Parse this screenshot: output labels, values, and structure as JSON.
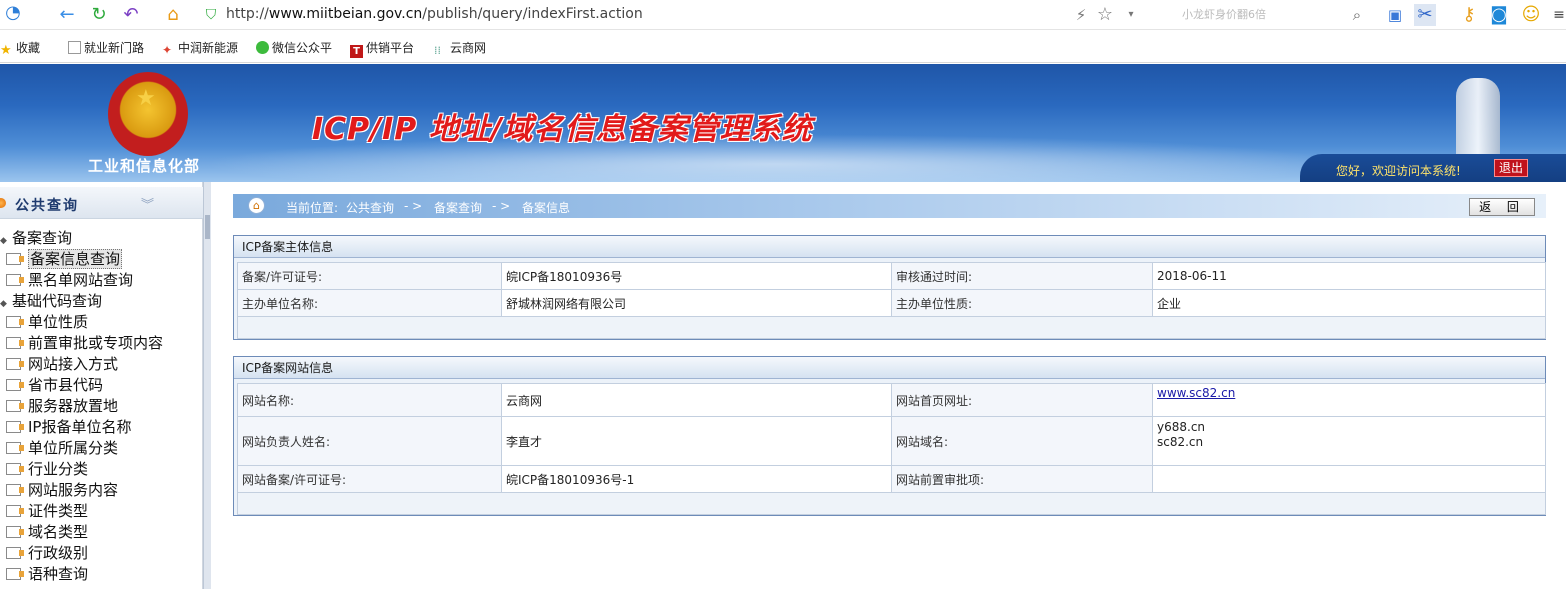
{
  "browser": {
    "url_prefix": "http://",
    "url_host": "www.miitbeian.gov.cn",
    "url_path": "/publish/query/indexFirst.action",
    "search_placeholder": "小龙虾身价翻6倍",
    "bookmarks": [
      {
        "label": "收藏"
      },
      {
        "label": "就业新门路"
      },
      {
        "label": "中润新能源"
      },
      {
        "label": "微信公众平"
      },
      {
        "label": "供销平台"
      },
      {
        "label": "云商网"
      }
    ]
  },
  "banner": {
    "ministry": "工业和信息化部",
    "title": "ICP/IP 地址/域名信息备案管理系统",
    "welcome": "您好，欢迎访问本系统!",
    "logout": "退出"
  },
  "sidebar": {
    "title": "公共查询",
    "groups": [
      {
        "label": "备案查询",
        "items": [
          "备案信息查询",
          "黑名单网站查询"
        ]
      },
      {
        "label": "基础代码查询",
        "items": [
          "单位性质",
          "前置审批或专项内容",
          "网站接入方式",
          "省市县代码",
          "服务器放置地",
          "IP报备单位名称",
          "单位所属分类",
          "行业分类",
          "网站服务内容",
          "证件类型",
          "域名类型",
          "行政级别",
          "语种查询"
        ]
      }
    ]
  },
  "breadcrumb": {
    "prefix": "当前位置:",
    "parts": [
      "公共查询",
      "- >",
      "备案查询",
      "- >",
      "备案信息"
    ]
  },
  "back_button": "返 回",
  "subject_panel": {
    "title": "ICP备案主体信息",
    "rows": [
      [
        "备案/许可证号:",
        "皖ICP备18010936号",
        "审核通过时间:",
        "2018-06-11"
      ],
      [
        "主办单位名称:",
        "舒城林润网络有限公司",
        "主办单位性质:",
        "企业"
      ]
    ]
  },
  "site_panel": {
    "title": "ICP备案网站信息",
    "site_name_label": "网站名称:",
    "site_name": "云商网",
    "homepage_label": "网站首页网址:",
    "homepage": "www.sc82.cn",
    "owner_label": "网站负责人姓名:",
    "owner": "李直才",
    "domain_label": "网站域名:",
    "domains": [
      "y688.cn",
      "sc82.cn"
    ],
    "license_label": "网站备案/许可证号:",
    "license": "皖ICP备18010936号-1",
    "preapproval_label": "网站前置审批项:",
    "preapproval": ""
  }
}
